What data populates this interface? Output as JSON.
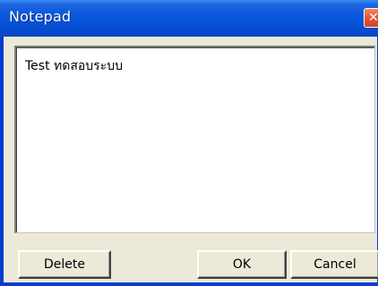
{
  "window": {
    "title": "Notepad",
    "close_glyph": "✕"
  },
  "editor": {
    "value": "Test ทดสอบระบบ"
  },
  "buttons": {
    "delete": "Delete",
    "ok": "OK",
    "cancel": "Cancel"
  },
  "colors": {
    "titlebar": "#0958dd",
    "close_button": "#e2583a",
    "window_body": "#ece9d8"
  }
}
